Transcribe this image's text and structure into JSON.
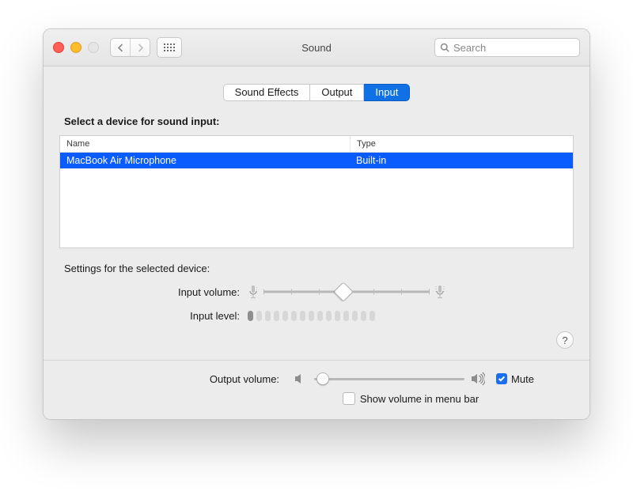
{
  "window": {
    "title": "Sound"
  },
  "search": {
    "placeholder": "Search"
  },
  "tabs": {
    "effects": "Sound Effects",
    "output": "Output",
    "input": "Input"
  },
  "section": {
    "header": "Select a device for sound input:",
    "col_name": "Name",
    "col_type": "Type"
  },
  "devices": [
    {
      "name": "MacBook Air Microphone",
      "type": "Built-in"
    }
  ],
  "settings": {
    "header": "Settings for the selected device:",
    "input_volume_label": "Input volume:",
    "input_level_label": "Input level:",
    "input_volume_percent": 48,
    "input_level_segments": 15,
    "input_level_active": 1
  },
  "help": {
    "symbol": "?"
  },
  "footer": {
    "output_volume_label": "Output volume:",
    "output_volume_percent": 6,
    "mute_label": "Mute",
    "mute_checked": true,
    "menubar_label": "Show volume in menu bar",
    "menubar_checked": false
  }
}
